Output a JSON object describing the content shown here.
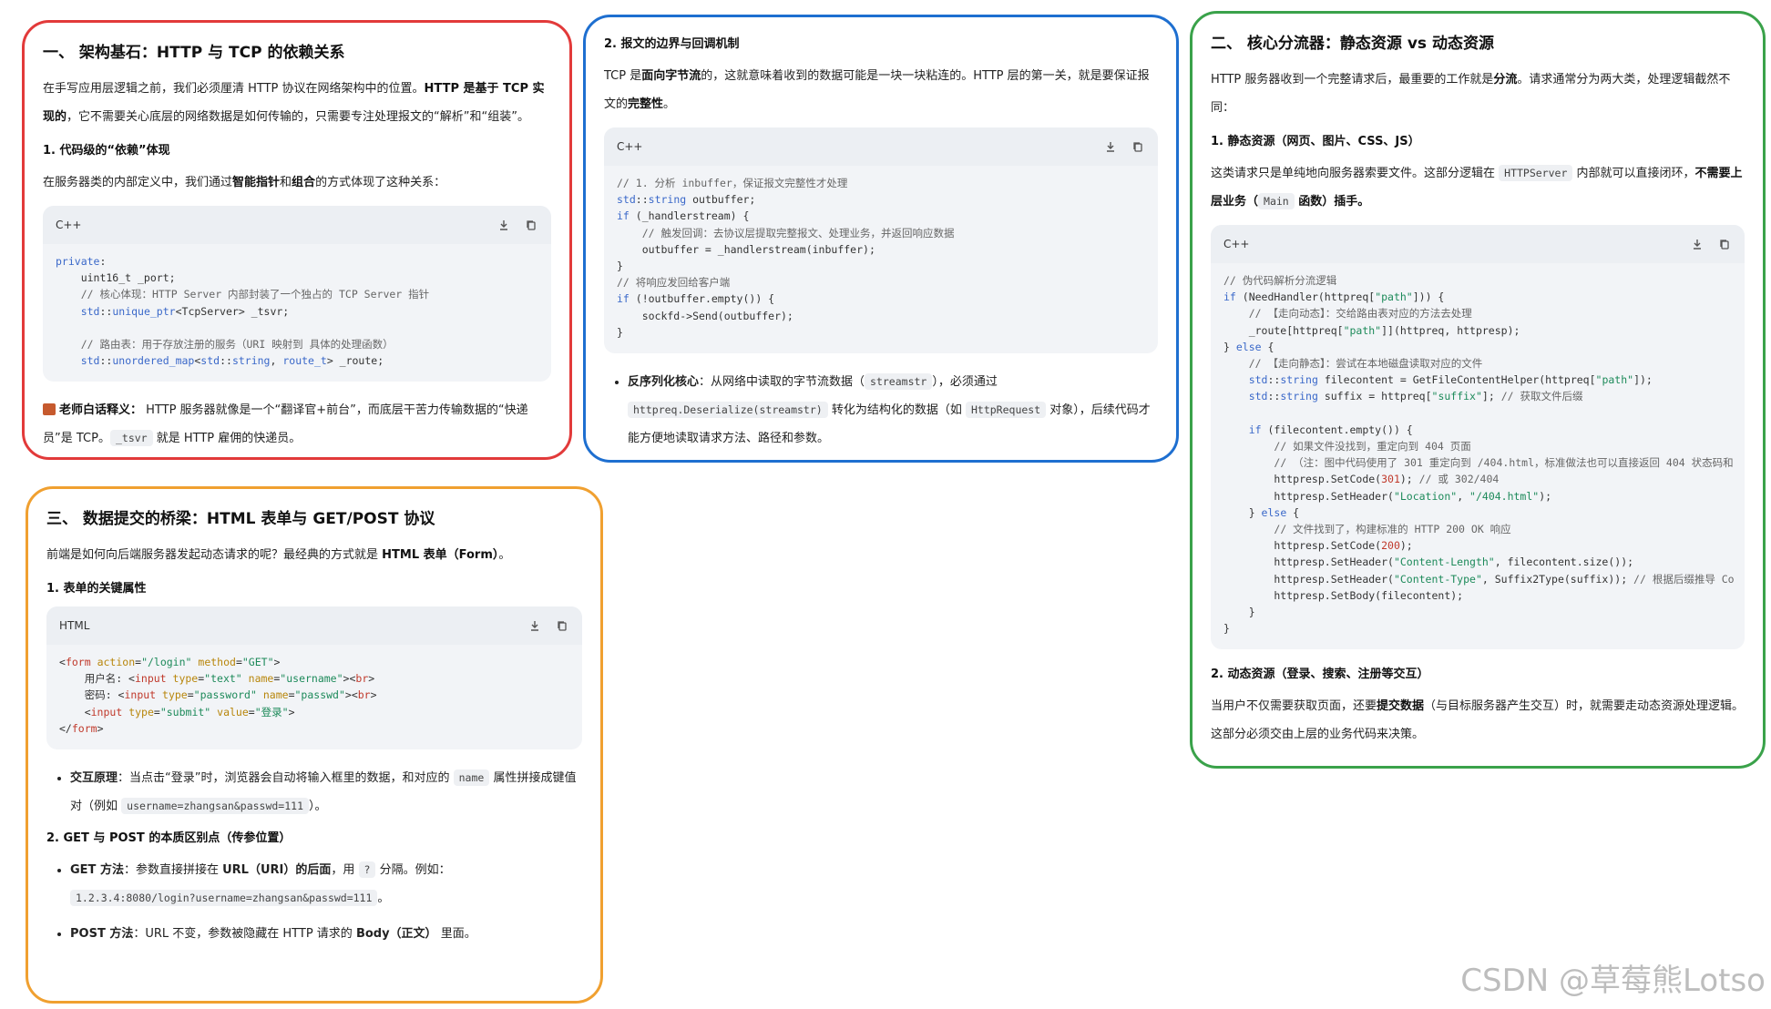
{
  "card1": {
    "title": "一、 架构基石：HTTP 与 TCP 的依赖关系",
    "intro_1": "在手写应用层逻辑之前，我们必须厘清 HTTP 协议在网络架构中的位置。",
    "intro_2_bold": "HTTP 是基于 TCP 实现的",
    "intro_3": "，它不需要关心底层的网络数据是如何传输的，只需要专注处理报文的“解析”和“组装”。",
    "sub1": "1. 代码级的“依赖”体现",
    "sub1_text_1": "在服务器类的内部定义中，我们通过",
    "sub1_text_b1": "智能指针",
    "sub1_text_2": "和",
    "sub1_text_b2": "组合",
    "sub1_text_3": "的方式体现了这种关系：",
    "code_lang": "C++",
    "note_icon": "books-icon",
    "note_bold": "老师白话释义：",
    "note_1": " HTTP 服务器就像是一个“翻译官+前台”，而底层干苦力传输数据的“快递员”是 TCP。",
    "note_code": "_tsvr",
    "note_2": " 就是 HTTP 雇佣的快递员。"
  },
  "card2": {
    "title": "2. 报文的边界与回调机制",
    "t1": "TCP 是",
    "t1_b": "面向字节流",
    "t2": "的，这就意味着收到的数据可能是一块一块粘连的。HTTP 层的第一关，就是要保证报文的",
    "t2_b": "完整性",
    "t3": "。",
    "code_lang": "C++",
    "li_bold": "反序列化核心",
    "li_1": "：从网络中读取的字节流数据（",
    "li_code1": "streamstr",
    "li_2": "），必须通过 ",
    "li_code2": "httpreq.Deserialize(streamstr)",
    "li_3": " 转化为结构化的数据（如 ",
    "li_code3": "HttpRequest",
    "li_4": " 对象），后续代码才能方便地读取请求方法、路径和参数。"
  },
  "card3": {
    "title": "二、 核心分流器：静态资源 vs 动态资源",
    "t1": "HTTP 服务器收到一个完整请求后，最重要的工作就是",
    "t1_b": "分流",
    "t2": "。请求通常分为两大类，处理逻辑截然不同：",
    "sub1": "1. 静态资源（网页、图片、CSS、JS）",
    "s1_1": "这类请求只是单纯地向服务器索要文件。这部分逻辑在 ",
    "s1_code": "HTTPServer",
    "s1_2": " 内部就可以直接闭环，",
    "s1_b": "不需要上层业务（",
    "s1_code2": "Main",
    "s1_b2": " 函数）插手。",
    "code_lang": "C++",
    "sub2": "2. 动态资源（登录、搜索、注册等交互）",
    "s2_1": "当用户不仅需要获取页面，还要",
    "s2_b": "提交数据",
    "s2_2": "（与目标服务器产生交互）时，就需要走动态资源处理逻辑。这部分必须交由上层的业务代码来决策。"
  },
  "card4": {
    "title": "三、 数据提交的桥梁：HTML 表单与 GET/POST 协议",
    "t1": "前端是如何向后端服务器发起动态请求的呢？最经典的方式就是 ",
    "t1_b": "HTML 表单（Form）",
    "t2": "。",
    "sub1": "1. 表单的关键属性",
    "code_lang": "HTML",
    "li1_b": "交互原理",
    "li1_1": "：当点击“登录”时，浏览器会自动将输入框里的数据，和对应的 ",
    "li1_code": "name",
    "li1_2": " 属性拼接成键值对（例如 ",
    "li1_code2": "username=zhangsan&passwd=111",
    "li1_3": "）。",
    "sub2": "2. GET 与 POST 的本质区别点（传参位置）",
    "li2_b": "GET 方法",
    "li2_1": "：参数直接拼接在 ",
    "li2_b2": "URL（URI）的后面",
    "li2_2": "，用 ",
    "li2_code": "?",
    "li2_3": " 分隔。例如：",
    "li2_code2": "1.2.3.4:8080/login?username=zhangsan&passwd=111",
    "li2_4": "。",
    "li3_b": "POST 方法",
    "li3_1": "：URL 不变，参数被隐藏在 HTTP 请求的 ",
    "li3_b2": "Body（正文）",
    "li3_2": " 里面。"
  },
  "watermark": "CSDN @草莓熊Lotso"
}
